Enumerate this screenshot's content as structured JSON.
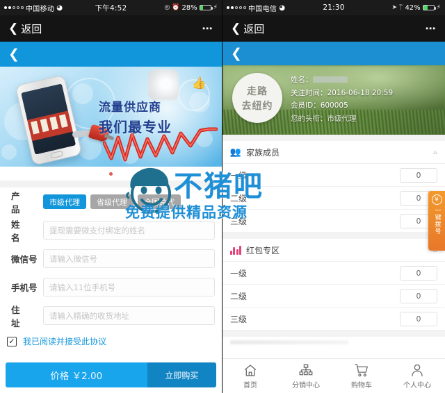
{
  "left_phone": {
    "status_bar": {
      "carrier": "中国移动",
      "wifi_icon": "wifi-icon",
      "time": "下午4:52",
      "battery_percent": "28%",
      "icons": [
        "lock-rotation-icon",
        "alarm-icon",
        "battery-icon",
        "charging-bolt-icon"
      ]
    },
    "wechat_nav": {
      "back_label": "返回",
      "back_icon": "chevron-left-icon",
      "more_icon": "more-dots-icon"
    },
    "app_header": {
      "back_icon": "chevron-left-icon"
    },
    "banner": {
      "headline_1": "流量供应商",
      "headline_2": "我们最专业",
      "thumb_icon": "thumbs-up-icon",
      "indicator_count": 1
    },
    "form": {
      "rows": [
        {
          "label": "产　品",
          "type": "pills"
        },
        {
          "label": "姓　名",
          "type": "input",
          "placeholder": "提现需要微支付绑定的姓名",
          "value": ""
        },
        {
          "label": "微信号",
          "type": "input",
          "placeholder": "请输入微信号",
          "value": ""
        },
        {
          "label": "手机号",
          "type": "input",
          "placeholder": "请输入11位手机号",
          "value": ""
        },
        {
          "label": "住　址",
          "type": "input",
          "placeholder": "请输入精确的收货地址",
          "value": ""
        }
      ],
      "product_options": [
        {
          "label": "市级代理",
          "selected": true
        },
        {
          "label": "省级代理",
          "selected": false
        },
        {
          "label": "全国总代",
          "selected": false
        }
      ]
    },
    "agreement": {
      "checked": true,
      "check_icon": "checkbox-checked-icon",
      "text": "我已阅读并接受此协议"
    },
    "buy_bar": {
      "price_label": "价格 ￥2.00",
      "buy_label": "立即购买"
    }
  },
  "right_phone": {
    "status_bar": {
      "carrier": "中国电信",
      "wifi_icon": "wifi-icon",
      "time": "21:30",
      "battery_percent": "42%",
      "icons": [
        "location-arrow-icon",
        "bluetooth-icon",
        "battery-icon",
        "charging-bolt-icon"
      ]
    },
    "wechat_nav": {
      "back_label": "返回",
      "back_icon": "chevron-left-icon",
      "more_icon": "more-dots-icon"
    },
    "app_header": {
      "back_icon": "chevron-left-icon"
    },
    "profile": {
      "avatar_line1": "走路",
      "avatar_line2": "去纽约",
      "name_label": "姓名：",
      "name_value": "",
      "follow_time_label": "关注时间：",
      "follow_time_value": "2016-06-18 20:59",
      "member_id_label": "会员ID：",
      "member_id_value": "600005",
      "title_label": "您的头衔：",
      "title_value": "市级代理"
    },
    "sections": [
      {
        "icon": "family-group-icon",
        "title": "家族成员",
        "caret_icon": "chevron-up-icon",
        "rows": [
          {
            "label": "一级",
            "value": "0"
          },
          {
            "label": "二级",
            "value": "0"
          },
          {
            "label": "三级",
            "value": "0"
          }
        ]
      },
      {
        "icon": "bar-chart-icon",
        "title": "红包专区",
        "caret_icon": "chevron-up-icon",
        "rows": [
          {
            "label": "一级",
            "value": "0"
          },
          {
            "label": "二级",
            "value": "0"
          },
          {
            "label": "三级",
            "value": "0"
          }
        ]
      }
    ],
    "side_tab": {
      "icon": "coin-icon",
      "text": "一键拨号"
    },
    "tab_bar": [
      {
        "icon": "home-icon",
        "label": "首页"
      },
      {
        "icon": "distribution-network-icon",
        "label": "分销中心"
      },
      {
        "icon": "shopping-cart-icon",
        "label": "购物车"
      },
      {
        "icon": "person-icon",
        "label": "个人中心"
      }
    ]
  },
  "watermark": {
    "brand": "不猪吧",
    "tagline": "免费提供精品资源",
    "face_icon": "boy-face-icon"
  }
}
